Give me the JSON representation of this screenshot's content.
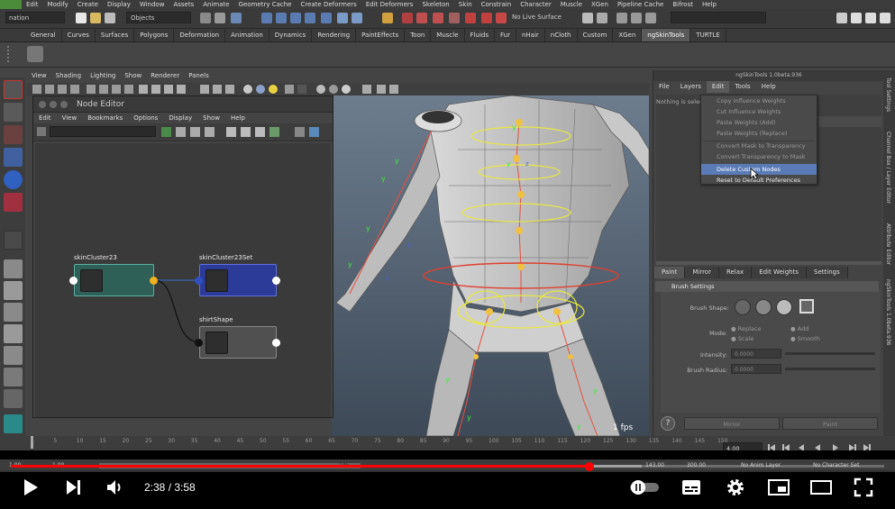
{
  "maya": {
    "menubar": [
      "Edit",
      "Modify",
      "Create",
      "Display",
      "Window",
      "Assets",
      "Animate",
      "Geometry Cache",
      "Create Deformers",
      "Edit Deformers",
      "Skeleton",
      "Skin",
      "Constrain",
      "Character",
      "Muscle",
      "XGen",
      "Pipeline Cache",
      "Bifrost",
      "Help"
    ],
    "mode_selector": "nation",
    "objects_field": "Objects",
    "live_surface": "No Live Surface",
    "shelf_tabs": [
      "General",
      "Curves",
      "Surfaces",
      "Polygons",
      "Deformation",
      "Animation",
      "Dynamics",
      "Rendering",
      "PaintEffects",
      "Toon",
      "Muscle",
      "Fluids",
      "Fur",
      "nHair",
      "nCloth",
      "Custom",
      "XGen",
      "ngSkinTools",
      "TURTLE"
    ],
    "active_shelf_tab": "ngSkinTools",
    "viewport_menu": [
      "View",
      "Shading",
      "Lighting",
      "Show",
      "Renderer",
      "Panels"
    ],
    "fps": "1 fps"
  },
  "node_editor": {
    "title": "Node Editor",
    "menu": [
      "Edit",
      "View",
      "Bookmarks",
      "Options",
      "Display",
      "Show",
      "Help"
    ],
    "nodes": [
      {
        "name": "skinCluster23"
      },
      {
        "name": "skinCluster23Set"
      },
      {
        "name": "shirtShape"
      }
    ]
  },
  "ngskintools": {
    "title": "ngSkinTools 1.0beta.936",
    "menu": [
      "File",
      "Layers",
      "Edit",
      "Tools",
      "Help"
    ],
    "active_menu": "Edit",
    "status_text": "Nothing is selec",
    "dropdown": [
      {
        "label": "Copy Influence Weights",
        "enabled": false
      },
      {
        "label": "Cut Influence Weights",
        "enabled": false
      },
      {
        "label": "Paste Weights (Add)",
        "enabled": false
      },
      {
        "label": "Paste Weights (Replace)",
        "enabled": false
      },
      {
        "label": "Convert Mask to Transparency",
        "enabled": false
      },
      {
        "label": "Convert Transparency to Mask",
        "enabled": false
      },
      {
        "label": "Delete Custom Nodes",
        "enabled": true,
        "highlighted": true
      },
      {
        "label": "Reset to Default Preferences",
        "enabled": true
      }
    ],
    "tabs": [
      "Paint",
      "Mirror",
      "Relax",
      "Edit Weights",
      "Settings"
    ],
    "active_tab": "Paint",
    "brush_header": "Brush Settings",
    "brush_shape_label": "Brush Shape:",
    "mode_label": "Mode:",
    "modes": [
      "Replace",
      "Add",
      "Scale",
      "Smooth"
    ],
    "intensity_label": "Intensity:",
    "intensity_value": "0.0000",
    "radius_label": "Brush Radius:",
    "radius_value": "0.0000",
    "btn_mirror": "Mirror",
    "btn_paint": "Paint",
    "help_glyph": "?"
  },
  "right_tabs": [
    "Tool Settings",
    "Channel Box / Layer Editor",
    "Attribute Editor",
    "ngSkinTools 1.0beta.936"
  ],
  "timeline": {
    "ticks": [
      "1",
      "5",
      "10",
      "15",
      "20",
      "25",
      "30",
      "35",
      "40",
      "45",
      "50",
      "55",
      "60",
      "65",
      "70",
      "75",
      "80",
      "85",
      "90",
      "95",
      "100",
      "105",
      "110",
      "115",
      "120",
      "125",
      "130",
      "135",
      "140",
      "145",
      "150"
    ],
    "current_frame": "4.00",
    "range_start": "1.00",
    "range_start2": "1.00",
    "range_mid": "145",
    "range_end": "143.00",
    "range_end2": "300.00",
    "anim_layer": "No Anim Layer",
    "character_set": "No Character Set"
  },
  "youtube": {
    "time": "2:38 / 3:58",
    "progress": 0.663,
    "loaded": 0.722,
    "accent": "#ff0000"
  }
}
